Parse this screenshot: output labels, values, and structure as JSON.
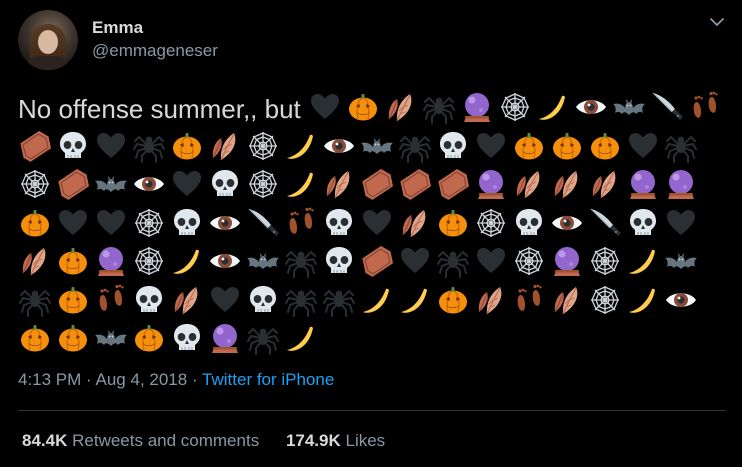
{
  "author": {
    "name": "Emma",
    "handle": "@emmageneser"
  },
  "tweet": {
    "text": "No offense summer,, but",
    "emoji_sequence": [
      "heart",
      "pumpkin",
      "leaves",
      "spider",
      "crystal-ball",
      "web",
      "moon",
      "eye",
      "bat",
      "knife",
      "footprints",
      "coffin",
      "skull",
      "heart",
      "spider",
      "pumpkin",
      "leaves",
      "web",
      "moon",
      "eye",
      "bat",
      "spider",
      "skull",
      "heart",
      "pumpkin",
      "pumpkin",
      "pumpkin",
      "heart",
      "spider",
      "web",
      "coffin",
      "bat",
      "eye",
      "heart",
      "skull",
      "web",
      "moon",
      "leaves",
      "coffin",
      "coffin",
      "coffin",
      "crystal-ball",
      "leaves",
      "leaves",
      "leaves",
      "crystal-ball",
      "crystal-ball",
      "pumpkin",
      "heart",
      "heart",
      "web",
      "skull",
      "eye",
      "knife",
      "footprints",
      "skull",
      "heart",
      "leaves",
      "pumpkin",
      "web",
      "skull",
      "eye",
      "knife",
      "skull",
      "heart",
      "leaves",
      "pumpkin",
      "crystal-ball",
      "web",
      "moon",
      "eye",
      "bat",
      "spider",
      "skull",
      "coffin",
      "heart",
      "spider",
      "heart",
      "web",
      "crystal-ball",
      "web",
      "moon",
      "bat",
      "spider",
      "pumpkin",
      "footprints",
      "skull",
      "leaves",
      "heart",
      "skull",
      "spider",
      "spider",
      "moon",
      "moon",
      "pumpkin",
      "leaves",
      "footprints",
      "leaves",
      "web",
      "moon",
      "eye",
      "pumpkin",
      "pumpkin",
      "bat",
      "pumpkin",
      "skull",
      "crystal-ball",
      "spider",
      "moon"
    ]
  },
  "meta": {
    "time": "4:13 PM",
    "separator": "·",
    "date": "Aug 4, 2018",
    "source": "Twitter for iPhone"
  },
  "stats": {
    "retweets_count": "84.4K",
    "retweets_label": "Retweets and comments",
    "likes_count": "174.9K",
    "likes_label": "Likes"
  },
  "colors": {
    "background": "#000000",
    "text": "#d9d9d9",
    "secondary": "#8899a6",
    "link": "#1da1f2",
    "divider": "#2f3336"
  }
}
